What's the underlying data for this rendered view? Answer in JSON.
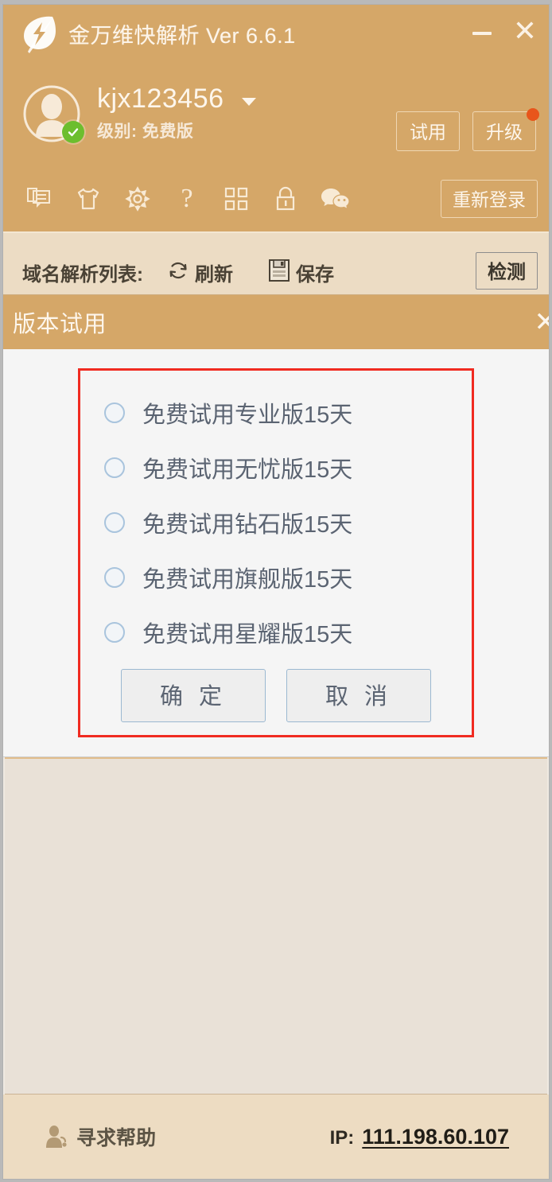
{
  "window": {
    "title": "金万维快解析 Ver 6.6.1",
    "logo_icon": "leaf-lightning-logo",
    "minimize_icon": "minimize-icon",
    "close_icon": "close-icon",
    "accent_color": "#d5a768",
    "panel_color": "#e9e1d7"
  },
  "account": {
    "avatar_icon": "user-avatar-icon",
    "verified_icon": "green-check-icon",
    "username": "kjx123456",
    "dropdown_icon": "caret-down-icon",
    "level_label": "级别: 免费版",
    "trial_button": "试用",
    "upgrade_button": "升级",
    "upgrade_badge_color": "#e8551b"
  },
  "toolbar": {
    "icons": [
      {
        "name": "message-icon"
      },
      {
        "name": "tshirt-skin-icon"
      },
      {
        "name": "gear-settings-icon"
      },
      {
        "name": "question-help-icon"
      },
      {
        "name": "grid-apps-icon"
      },
      {
        "name": "lock-icon"
      },
      {
        "name": "wechat-icon"
      }
    ],
    "relogin_button": "重新登录"
  },
  "list_strip": {
    "label": "域名解析列表:",
    "refresh_icon": "refresh-icon",
    "refresh_label": "刷新",
    "save_icon": "save-disk-icon",
    "save_label": "保存",
    "detect_button": "检测"
  },
  "trial_dialog": {
    "title": "版本试用",
    "close_icon": "dialog-close-icon",
    "highlight_color": "#f02b21",
    "options": [
      {
        "label": "免费试用专业版15天",
        "selected": false
      },
      {
        "label": "免费试用无忧版15天",
        "selected": false
      },
      {
        "label": "免费试用钻石版15天",
        "selected": false
      },
      {
        "label": "免费试用旗舰版15天",
        "selected": false
      },
      {
        "label": "免费试用星耀版15天",
        "selected": false
      }
    ],
    "confirm_button": "确 定",
    "cancel_button": "取 消"
  },
  "statusbar": {
    "help_icon": "person-support-icon",
    "help_label": "寻求帮助",
    "ip_label": "IP:",
    "ip_value": "111.198.60.107"
  }
}
